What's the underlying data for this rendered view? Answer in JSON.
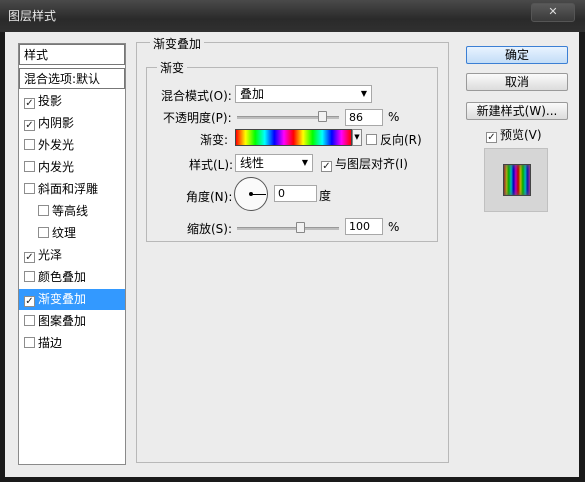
{
  "window": {
    "title": "图层样式",
    "close_label": "✕"
  },
  "left_panel": {
    "header": "样式",
    "blend_default": "混合选项:默认",
    "items": [
      {
        "label": "投影",
        "checked": true,
        "sub": false
      },
      {
        "label": "内阴影",
        "checked": true,
        "sub": false
      },
      {
        "label": "外发光",
        "checked": false,
        "sub": false
      },
      {
        "label": "内发光",
        "checked": false,
        "sub": false
      },
      {
        "label": "斜面和浮雕",
        "checked": false,
        "sub": false
      },
      {
        "label": "等高线",
        "checked": false,
        "sub": true
      },
      {
        "label": "纹理",
        "checked": false,
        "sub": true
      },
      {
        "label": "光泽",
        "checked": true,
        "sub": false
      },
      {
        "label": "颜色叠加",
        "checked": false,
        "sub": false
      },
      {
        "label": "渐变叠加",
        "checked": true,
        "sub": false,
        "selected": true
      },
      {
        "label": "图案叠加",
        "checked": false,
        "sub": false
      },
      {
        "label": "描边",
        "checked": false,
        "sub": false
      }
    ]
  },
  "main": {
    "section_title": "渐变叠加",
    "group_title": "渐变",
    "blend_mode_label": "混合模式(O):",
    "blend_mode_value": "叠加",
    "opacity_label": "不透明度(P):",
    "opacity_value": "86",
    "opacity_unit": "%",
    "gradient_label": "渐变:",
    "reverse_label": "反向(R)",
    "reverse_checked": false,
    "style_label": "样式(L):",
    "style_value": "线性",
    "align_label": "与图层对齐(I)",
    "align_checked": true,
    "angle_label": "角度(N):",
    "angle_value": "0",
    "angle_unit": "度",
    "scale_label": "缩放(S):",
    "scale_value": "100",
    "scale_unit": "%"
  },
  "buttons": {
    "ok": "确定",
    "cancel": "取消",
    "new_style": "新建样式(W)...",
    "preview_label": "预览(V)",
    "preview_checked": true
  },
  "colors": {
    "selection": "#3399ff",
    "dialog_bg": "#ececec"
  }
}
